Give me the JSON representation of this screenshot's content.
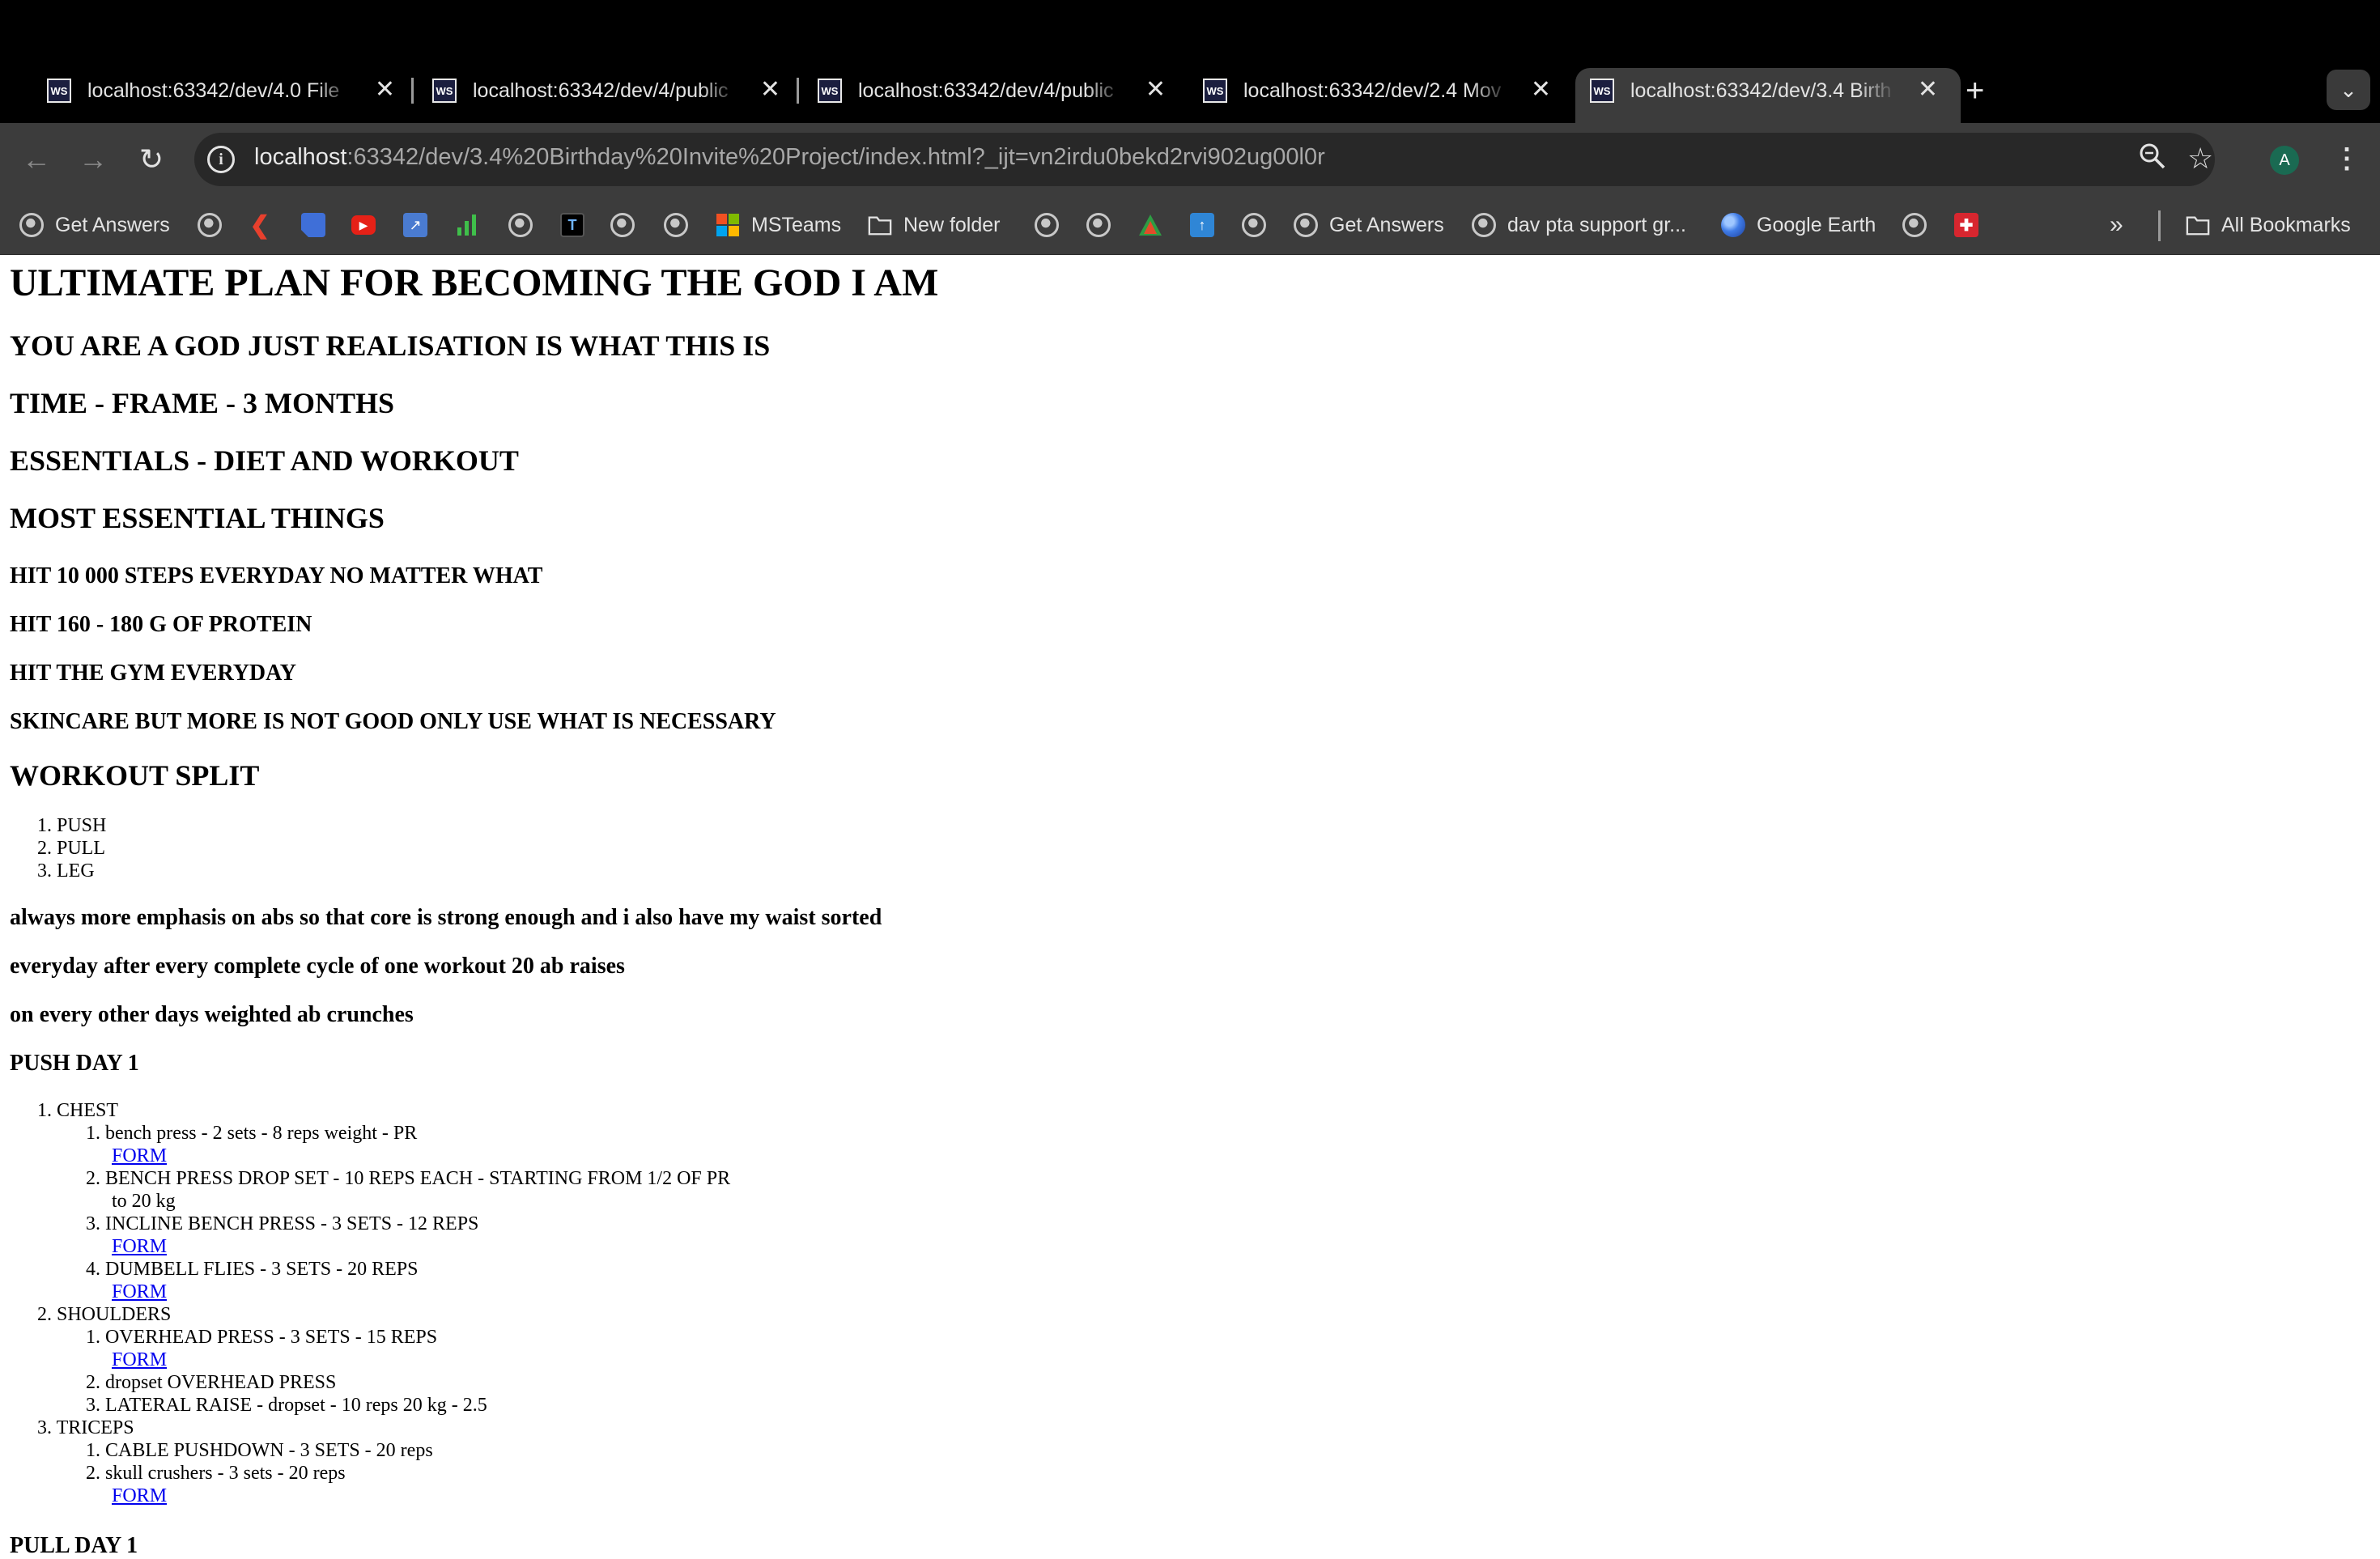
{
  "browser": {
    "tabs": [
      {
        "title": "localhost:63342/dev/4.0 File",
        "favicon": "WS"
      },
      {
        "title": "localhost:63342/dev/4/public",
        "favicon": "WS"
      },
      {
        "title": "localhost:63342/dev/4/public",
        "favicon": "WS"
      },
      {
        "title": "localhost:63342/dev/2.4 Mov",
        "favicon": "WS"
      },
      {
        "title": "localhost:63342/dev/3.4 Birth",
        "favicon": "WS",
        "active": true
      }
    ],
    "url_host": "localhost",
    "url_path": ":63342/dev/3.4%20Birthday%20Invite%20Project/index.html?_ijt=vn2irdu0bekd2rvi902ug00l0r",
    "profile_initial": "A",
    "bookmarks": {
      "get_answers_1": "Get Answers",
      "msteams": "MSTeams",
      "new_folder": "New folder",
      "get_answers_2": "Get Answers",
      "dav_pta": "dav pta support gr...",
      "google_earth": "Google Earth",
      "all_bookmarks": "All Bookmarks"
    }
  },
  "page": {
    "title": "ULTIMATE PLAN FOR BECOMING THE GOD I AM",
    "subtitle": "YOU ARE A GOD JUST REALISATION IS WHAT THIS IS",
    "timeframe": "TIME - FRAME - 3 MONTHS",
    "essentials": "ESSENTIALS - DIET AND WORKOUT",
    "most_essential": "MOST ESSENTIAL THINGS",
    "rules": [
      "HIT 10 000 STEPS EVERYDAY NO MATTER WHAT",
      "HIT 160 - 180 G OF PROTEIN",
      "HIT THE GYM EVERYDAY",
      "SKINCARE BUT MORE IS NOT GOOD ONLY USE WHAT IS NECESSARY"
    ],
    "split_heading": "WORKOUT SPLIT",
    "split": [
      "PUSH",
      "PULL",
      "LEG"
    ],
    "notes": [
      "always more emphasis on abs so that core is strong enough and i also have my waist sorted",
      "everyday after every complete cycle of one workout 20 ab raises",
      "on every other days weighted ab crunches"
    ],
    "push_heading": "PUSH DAY 1",
    "push": {
      "chest": "CHEST",
      "chest_items": [
        "bench press - 2 sets - 8 reps weight - PR",
        "BENCH PRESS DROP SET - 10 REPS EACH - STARTING FROM 1/2 OF PR",
        "to 20 kg",
        "INCLINE BENCH PRESS - 3 SETS - 12 REPS",
        "DUMBELL FLIES - 3 SETS - 20 REPS"
      ],
      "shoulders": "SHOULDERS",
      "shoulder_items": [
        "OVERHEAD PRESS - 3 SETS - 15 REPS",
        "dropset OVERHEAD PRESS",
        "LATERAL RAISE - dropset - 10 reps 20 kg - 2.5"
      ],
      "triceps": "TRICEPS",
      "tricep_items": [
        "CABLE PUSHDOWN - 3 SETS - 20 reps",
        "skull crushers - 3 sets - 20 reps"
      ],
      "form_link": "FORM"
    },
    "pull_heading": "PULL DAY 1"
  }
}
